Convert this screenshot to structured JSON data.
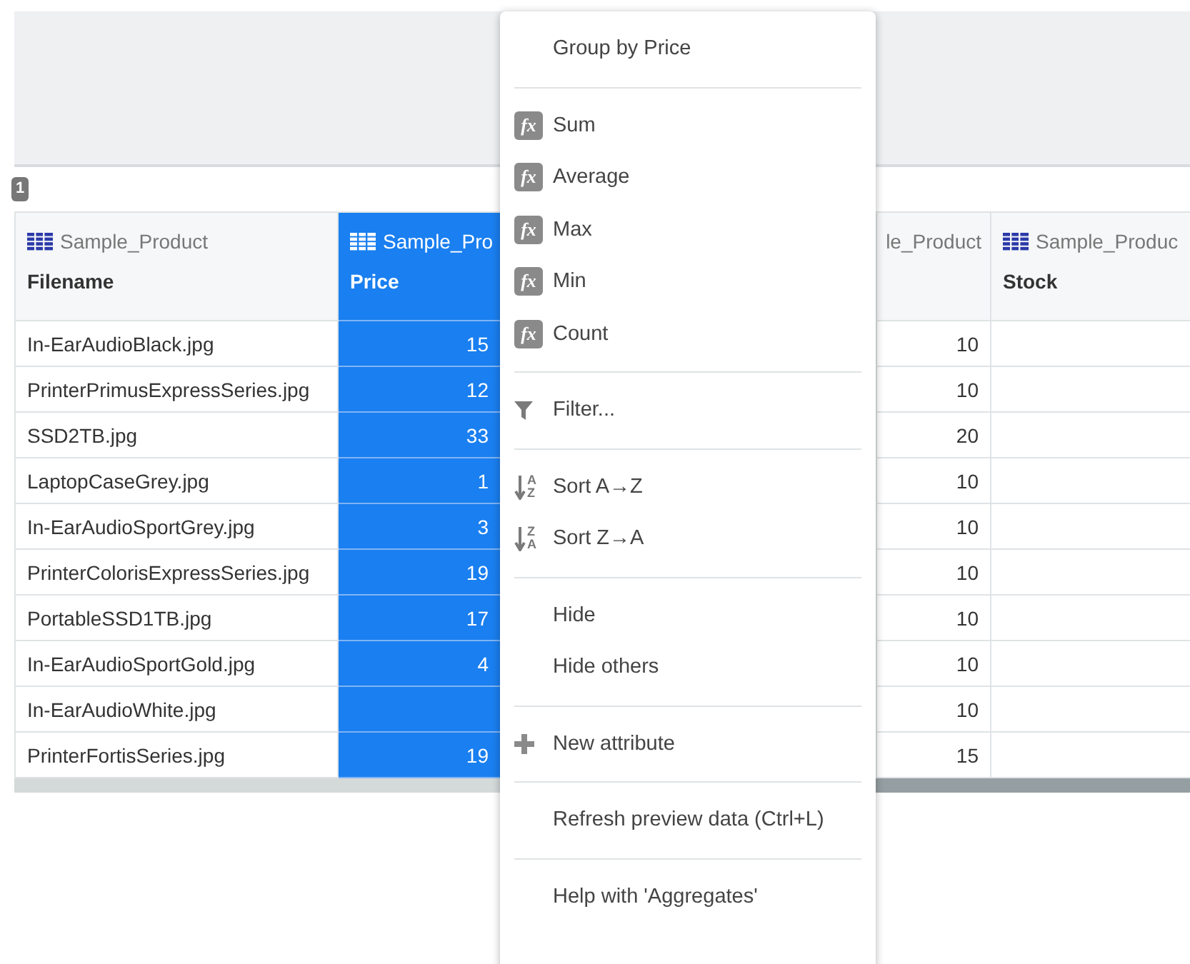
{
  "badge": "1",
  "table": {
    "columns": [
      {
        "source": "Sample_Product",
        "name": "Filename",
        "selected": false
      },
      {
        "source": "Sample_Pro",
        "name": "Price",
        "selected": true
      },
      {
        "source": "le_Product",
        "selected": false
      },
      {
        "source": "Sample_Produc",
        "name": "Stock",
        "selected": false
      }
    ],
    "rows": [
      [
        "In-EarAudioBlack.jpg",
        "15",
        "10"
      ],
      [
        "PrinterPrimusExpressSeries.jpg",
        "12",
        "10"
      ],
      [
        "SSD2TB.jpg",
        "33",
        "20"
      ],
      [
        "LaptopCaseGrey.jpg",
        "1",
        "10"
      ],
      [
        "In-EarAudioSportGrey.jpg",
        "3",
        "10"
      ],
      [
        "PrinterColorisExpressSeries.jpg",
        "19",
        "10"
      ],
      [
        "PortableSSD1TB.jpg",
        "17",
        "10"
      ],
      [
        "In-EarAudioSportGold.jpg",
        "4",
        "10"
      ],
      [
        "In-EarAudioWhite.jpg",
        null,
        "10"
      ],
      [
        "PrinterFortisSeries.jpg",
        "19",
        "15"
      ]
    ]
  },
  "menu": [
    [
      {
        "label": "Group by Price"
      }
    ],
    [
      {
        "label": "Sum",
        "kind": "fx",
        "icon_text": "fx"
      },
      {
        "label": "Average",
        "kind": "fx",
        "icon_text": "fx"
      },
      {
        "label": "Max",
        "kind": "fx",
        "icon_text": "fx"
      },
      {
        "label": "Min",
        "kind": "fx",
        "icon_text": "fx"
      },
      {
        "label": "Count",
        "kind": "fx",
        "icon_text": "fx"
      }
    ],
    [
      {
        "label": "Filter...",
        "kind": "filter"
      }
    ],
    [
      {
        "label": "Sort A→Z",
        "kind": "sort",
        "icon_top": "A",
        "icon_bottom": "Z"
      },
      {
        "label": "Sort Z→A",
        "kind": "sort",
        "icon_top": "Z",
        "icon_bottom": "A"
      }
    ],
    [
      {
        "label": "Hide"
      },
      {
        "label": "Hide others"
      }
    ],
    [
      {
        "label": "New attribute",
        "kind": "plus"
      }
    ],
    [
      {
        "label": "Refresh preview data (Ctrl+L)"
      }
    ],
    [
      {
        "label": "Help with 'Aggregates'"
      }
    ]
  ]
}
